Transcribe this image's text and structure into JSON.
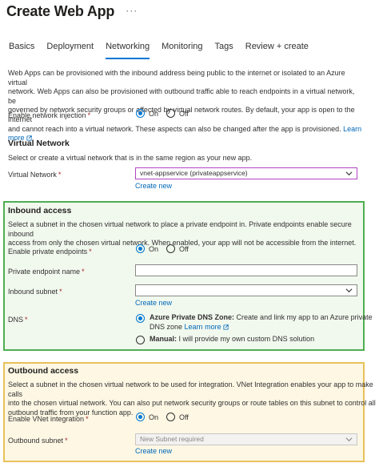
{
  "page": {
    "title": "Create Web App",
    "more_label": "···"
  },
  "tabs": [
    {
      "label": "Basics"
    },
    {
      "label": "Deployment"
    },
    {
      "label": "Networking"
    },
    {
      "label": "Monitoring"
    },
    {
      "label": "Tags"
    },
    {
      "label": "Review + create"
    }
  ],
  "intro": {
    "line1": "Web Apps can be provisioned with the inbound address being public to the internet or isolated to an Azure virtual",
    "line2": "network. Web Apps can also be provisioned with outbound traffic able to reach endpoints in a virtual network, be",
    "line3": "governed by network security groups or affected by virtual network routes. By default, your app is open to the internet",
    "line4": "and cannot reach into a virtual network. These aspects can also be changed after the app is provisioned.",
    "learn_more": "Learn more"
  },
  "network_injection": {
    "label": "Enable network injection",
    "options": [
      "On",
      "Off"
    ],
    "selected": "On"
  },
  "virtual_network": {
    "heading": "Virtual Network",
    "description": "Select or create a virtual network that is in the same region as your new app.",
    "label": "Virtual Network",
    "value": "vnet-appservice (privateappservice)",
    "create_new": "Create new"
  },
  "inbound": {
    "heading": "Inbound access",
    "desc_line1": "Select a subnet in the chosen virtual network to place a private endpoint in. Private endpoints enable secure inbound",
    "desc_line2": "access from only the chosen virtual network. When enabled, your app will not be accessible from the internet.",
    "private_endpoints_label": "Enable private endpoints",
    "private_endpoints_options": [
      "On",
      "Off"
    ],
    "private_endpoints_selected": "On",
    "endpoint_name_label": "Private endpoint name",
    "endpoint_name_value": "",
    "subnet_label": "Inbound subnet",
    "subnet_value": "",
    "create_new": "Create new",
    "dns_label": "DNS",
    "dns_azure_bold": "Azure Private DNS Zone:",
    "dns_azure_text": "Create and link my app to an Azure private",
    "dns_azure_text2": "DNS zone",
    "dns_learn_more": "Learn more",
    "dns_manual_bold": "Manual:",
    "dns_manual_text": "I will provide my own custom DNS solution",
    "dns_selected": "Azure Private DNS Zone"
  },
  "outbound": {
    "heading": "Outbound access",
    "desc_line1": "Select a subnet in the chosen virtual network to be used for integration. VNet Integration enables your app to make calls",
    "desc_line2": "into the chosen virtual network. You can also put network security groups or route tables on this subnet to control all",
    "desc_line3": "outbound traffic from your function app.",
    "vnet_integration_label": "Enable VNet integration",
    "vnet_integration_options": [
      "On",
      "Off"
    ],
    "vnet_integration_selected": "On",
    "subnet_label": "Outbound subnet",
    "subnet_value": "New Subnet required",
    "create_new": "Create new"
  },
  "colors": {
    "accent": "#0078d4",
    "link": "#0067b8",
    "required": "#a4262c",
    "inbound_border": "#4fae52",
    "outbound_border": "#e8c15a",
    "vnet_dropdown_border": "#b146c2"
  }
}
